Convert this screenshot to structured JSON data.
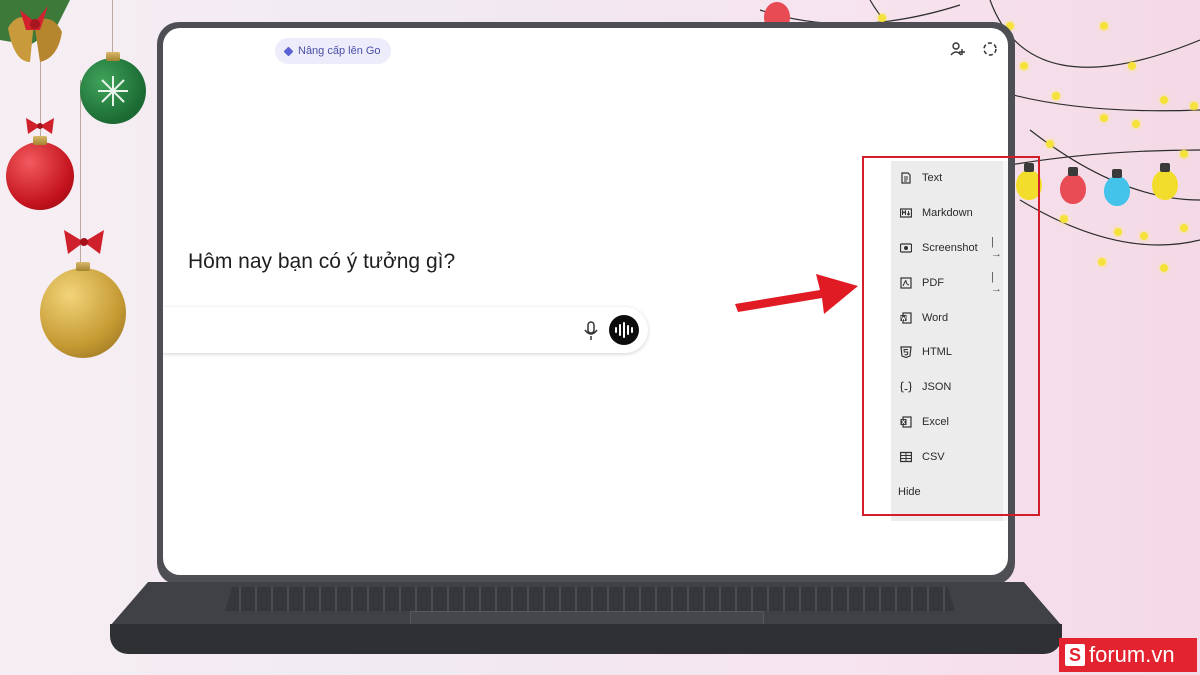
{
  "app": {
    "upgrade_button_label": "Nâng cấp lên Go",
    "greeting": "Hôm nay bạn có ý tưởng gì?",
    "input_placeholder": "",
    "icons": [
      "add-user-icon",
      "temporary-chat-icon",
      "microphone-icon",
      "voice-mode-icon"
    ]
  },
  "export_menu": {
    "items": [
      {
        "label": "Text",
        "icon": "document-icon",
        "has_arrow": false
      },
      {
        "label": "Markdown",
        "icon": "markdown-icon",
        "has_arrow": false
      },
      {
        "label": "Screenshot",
        "icon": "screenshot-icon",
        "has_arrow": true
      },
      {
        "label": "PDF",
        "icon": "pdf-icon",
        "has_arrow": true
      },
      {
        "label": "Word",
        "icon": "word-icon",
        "has_arrow": false
      },
      {
        "label": "HTML",
        "icon": "html5-icon",
        "has_arrow": false
      },
      {
        "label": "JSON",
        "icon": "json-icon",
        "has_arrow": false
      },
      {
        "label": "Excel",
        "icon": "excel-icon",
        "has_arrow": false
      },
      {
        "label": "CSV",
        "icon": "table-icon",
        "has_arrow": false
      }
    ],
    "hide_label": "Hide",
    "arrow_glyph": "|→"
  },
  "branding": {
    "logo_letter": "S",
    "site": "forum.vn"
  },
  "colors": {
    "highlight_red": "#d21e2b",
    "brand_red": "#e3232f",
    "laptop_frame": "#4d4f55"
  }
}
